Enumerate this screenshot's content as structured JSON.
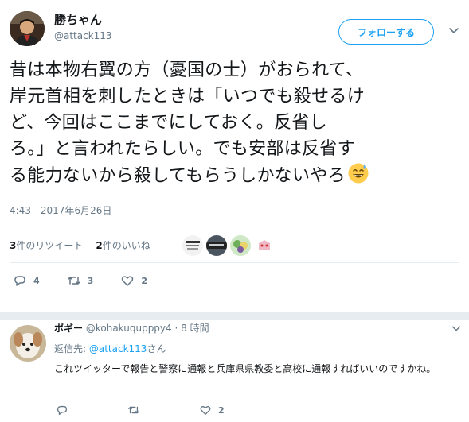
{
  "tweet": {
    "author_name": "勝ちゃん",
    "author_handle": "@attack113",
    "follow_label": "フォローする",
    "text_lines": [
      "昔は本物右翼の方（憂国の士）がおられて、",
      "岸元首相を刺したときは「いつでも殺せるけ",
      "ど、今回はここまでにしておく。反省し",
      "ろ。」と言われたらしい。でも安部は反省す",
      "る能力ないから殺してもらうしかないやろ"
    ],
    "emoji_icon": "sweat-smile-emoji",
    "timestamp": "4:43 - 2017年6月26日",
    "retweets_count": "3",
    "retweets_label": "件のリツイート",
    "likes_count": "2",
    "likes_label": "件のいいね",
    "actions": {
      "reply_count": "4",
      "retweet_count": "3",
      "like_count": "2"
    }
  },
  "reply": {
    "name": "ポギー",
    "handle": "@kohakuqupppy4",
    "time": "· 8 時間",
    "reply_to_prefix": "返信先: ",
    "reply_to_handle": "@attack113",
    "reply_to_suffix": "さん",
    "text": "これツイッターで報告と警察に通報と兵庫県県教委と高校に通報すればいいのですかね。",
    "actions": {
      "reply_count": "",
      "retweet_count": "",
      "like_count": "2"
    }
  },
  "colors": {
    "accent": "#1da1f2",
    "muted": "#657786",
    "text": "#14171a",
    "divider": "#e6ecf0"
  }
}
